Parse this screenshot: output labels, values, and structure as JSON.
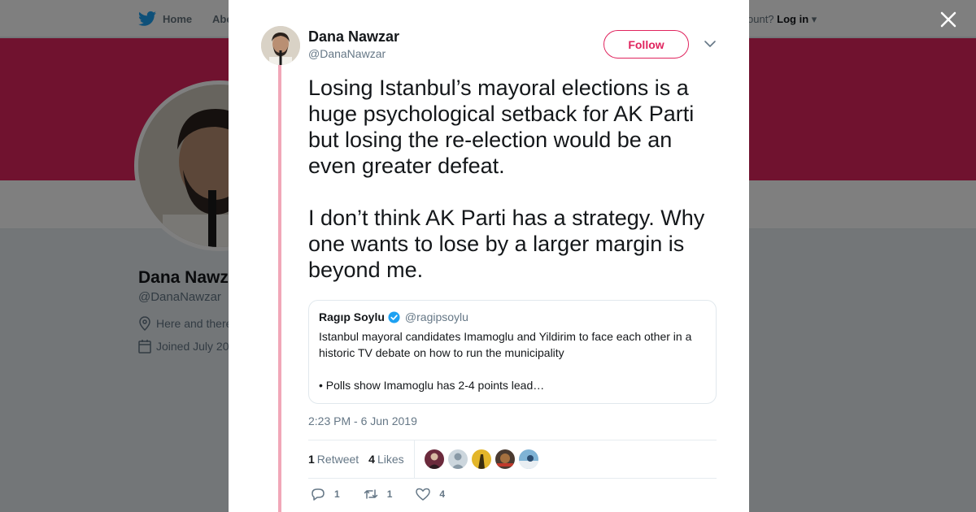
{
  "nav": {
    "home_label": "Home",
    "about_label": "Abo",
    "login_prefix": "ccount?",
    "login_label": "Log in"
  },
  "profile": {
    "name": "Dana Nawz",
    "handle": "@DanaNawzar",
    "location": "Here and there",
    "joined": "Joined July 20"
  },
  "tweet": {
    "author_name": "Dana Nawzar",
    "author_handle": "@DanaNawzar",
    "follow_label": "Follow",
    "paragraph_1": "Losing Istanbul’s mayoral elections is a huge psychological setback for AK Parti but losing the re-election would be an even greater defeat.",
    "paragraph_2": "I don’t think AK Parti has a strategy. Why one wants to lose by a larger margin is beyond me.",
    "timestamp": "2:23 PM - 6 Jun 2019",
    "retweets_count": "1",
    "retweets_label": "Retweet",
    "likes_count": "4",
    "likes_label": "Likes",
    "reply_count": "1",
    "retweet_action_count": "1",
    "like_action_count": "4"
  },
  "quote": {
    "name": "Ragıp Soylu",
    "handle": "@ragipsoylu",
    "line_1": "Istanbul mayoral candidates Imamoglu and Yildirim to face each other in a historic TV debate on how to run the municipality",
    "line_2": "• Polls show Imamoglu has 2-4 points lead…"
  },
  "colors": {
    "accent": "#e0245e",
    "thread_line": "#f1a7b8",
    "verified": "#1da1f2",
    "muted": "#657786",
    "twitter_blue": "#1da1f2"
  }
}
